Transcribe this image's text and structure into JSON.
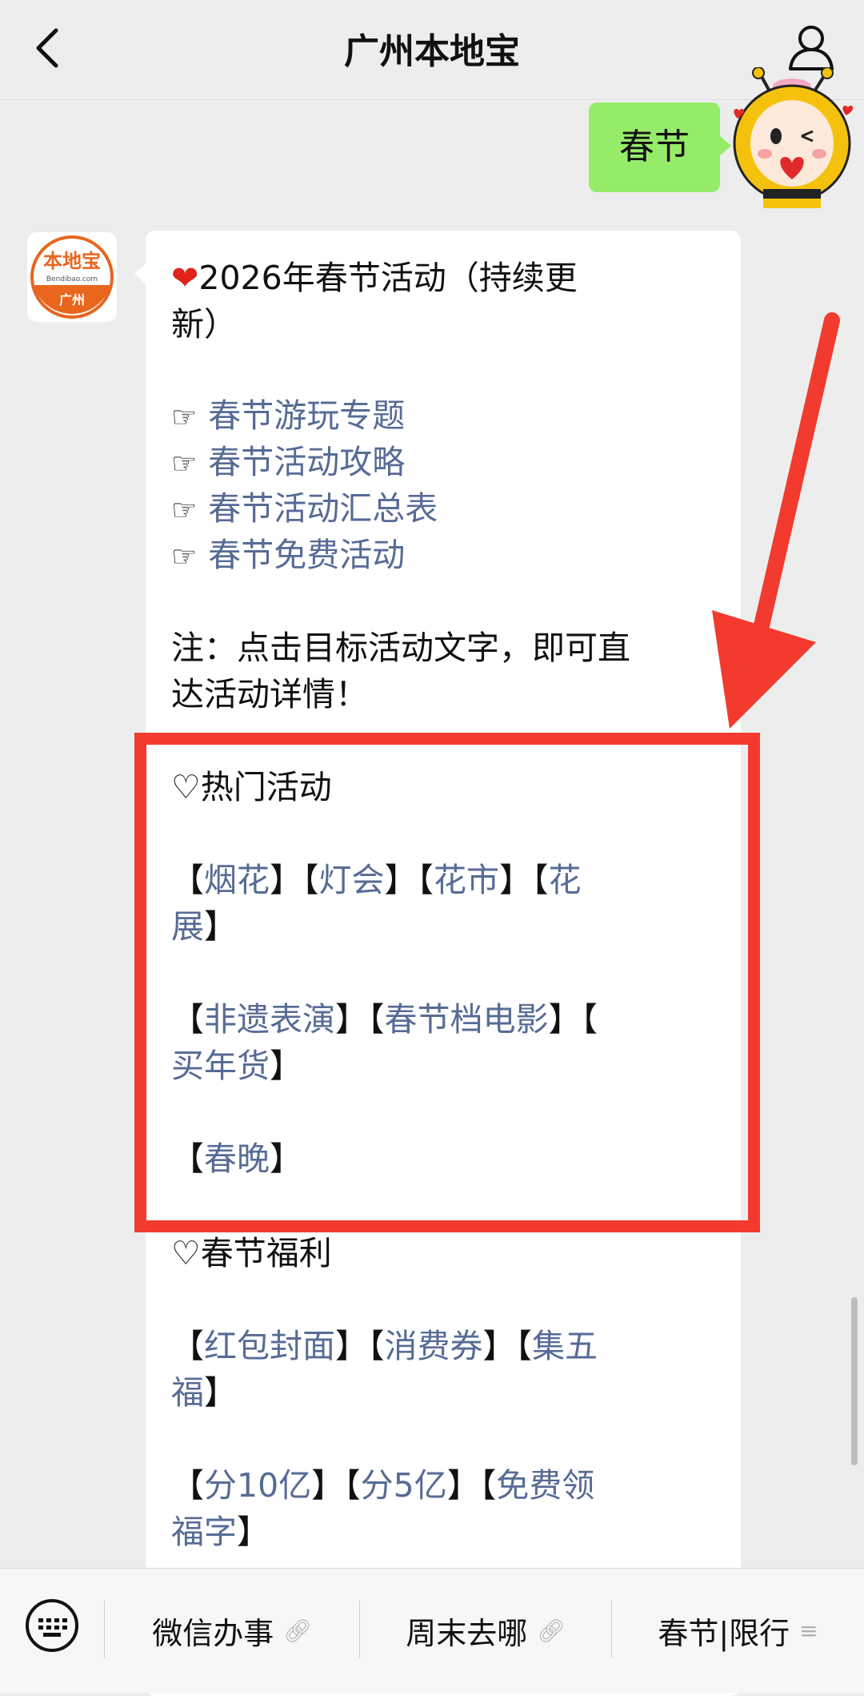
{
  "header": {
    "title": "广州本地宝"
  },
  "outgoing": {
    "message": "春节"
  },
  "avatar": {
    "brand": "本地宝",
    "domain": "Bendibao.com",
    "city": "广州"
  },
  "reply": {
    "headline": "2026年春节活动（持续更",
    "headline_cont": "新）",
    "links": [
      "春节游玩专题",
      "春节活动攻略",
      "春节活动汇总表",
      "春节免费活动"
    ],
    "note_line1": "注：点击目标活动文字，即可直",
    "note_line2": "达活动详情！",
    "hot_title": "♡热门活动",
    "hot": {
      "fireworks": "烟花",
      "lantern": "灯会",
      "flower_market": "花市",
      "flower_show_a": "花",
      "flower_show_b": "展",
      "heritage": "非遗表演",
      "movie": "春节档电影",
      "goods": "买年货",
      "gala": "春晚"
    },
    "welfare_title": "♡春节福利",
    "welfare": {
      "red_cover": "红包封面",
      "coupon": "消费券",
      "five_a": "集五",
      "five_b": "福",
      "billion10": "分10亿",
      "billion5": "分5亿",
      "free_a": "免费领",
      "free_b": "福字"
    }
  },
  "bottom_menu": {
    "item1": "微信办事",
    "item2": "周末去哪",
    "item3": "春节|限行"
  },
  "colors": {
    "link": "#576b95",
    "bubble_out": "#95ec69",
    "highlight": "#f23b2e",
    "background": "#ededed"
  }
}
